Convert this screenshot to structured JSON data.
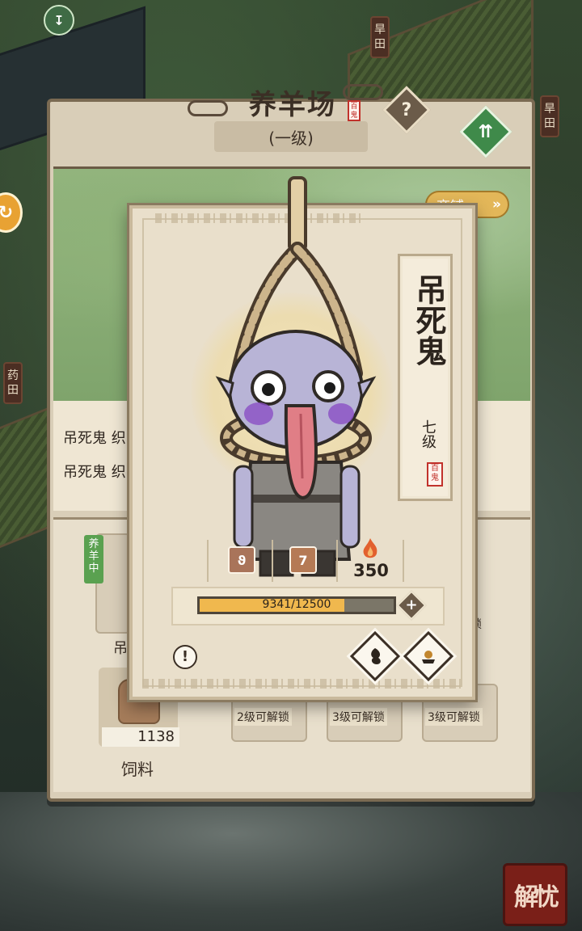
{
  "panel": {
    "title": "养羊场",
    "seal": "百鬼",
    "level": "(一级)",
    "help_label": "?",
    "shop_label": "商铺",
    "shop_chevron": "»",
    "log": [
      {
        "text": "吊死鬼 织"
      },
      {
        "text": "吊死鬼 织"
      }
    ],
    "raising_tag": "养羊中",
    "slot_name_partial": "吊",
    "locked_hint": "锁",
    "feed": {
      "count": "1138",
      "label": "饲料"
    },
    "unlock_slots": [
      {
        "text": "2级可解锁"
      },
      {
        "text": "3级可解锁"
      },
      {
        "text": "3级可解锁"
      }
    ]
  },
  "map": {
    "tags": [
      "旱田",
      "旱田",
      "药田"
    ]
  },
  "ghost_card": {
    "name": "吊死鬼",
    "level": "七级",
    "seal": "百鬼",
    "stats": {
      "badge_number": "7",
      "fire_value": "350"
    },
    "xp": {
      "current": 9341,
      "max": 12500,
      "text": "9341/12500"
    },
    "info_label": "!",
    "icons": [
      "spirit-icon",
      "level-badge-icon",
      "fire-icon",
      "plus-icon",
      "ghost-smoke-icon",
      "offering-icon"
    ]
  },
  "corner_button": {
    "label": "解忧"
  },
  "colors": {
    "xp_fill": "#f0b84e",
    "grass": "#93b57e",
    "parchment": "#e9dfcb",
    "seal_red": "#c1322b",
    "upgrade_green": "#3f8a4a"
  }
}
